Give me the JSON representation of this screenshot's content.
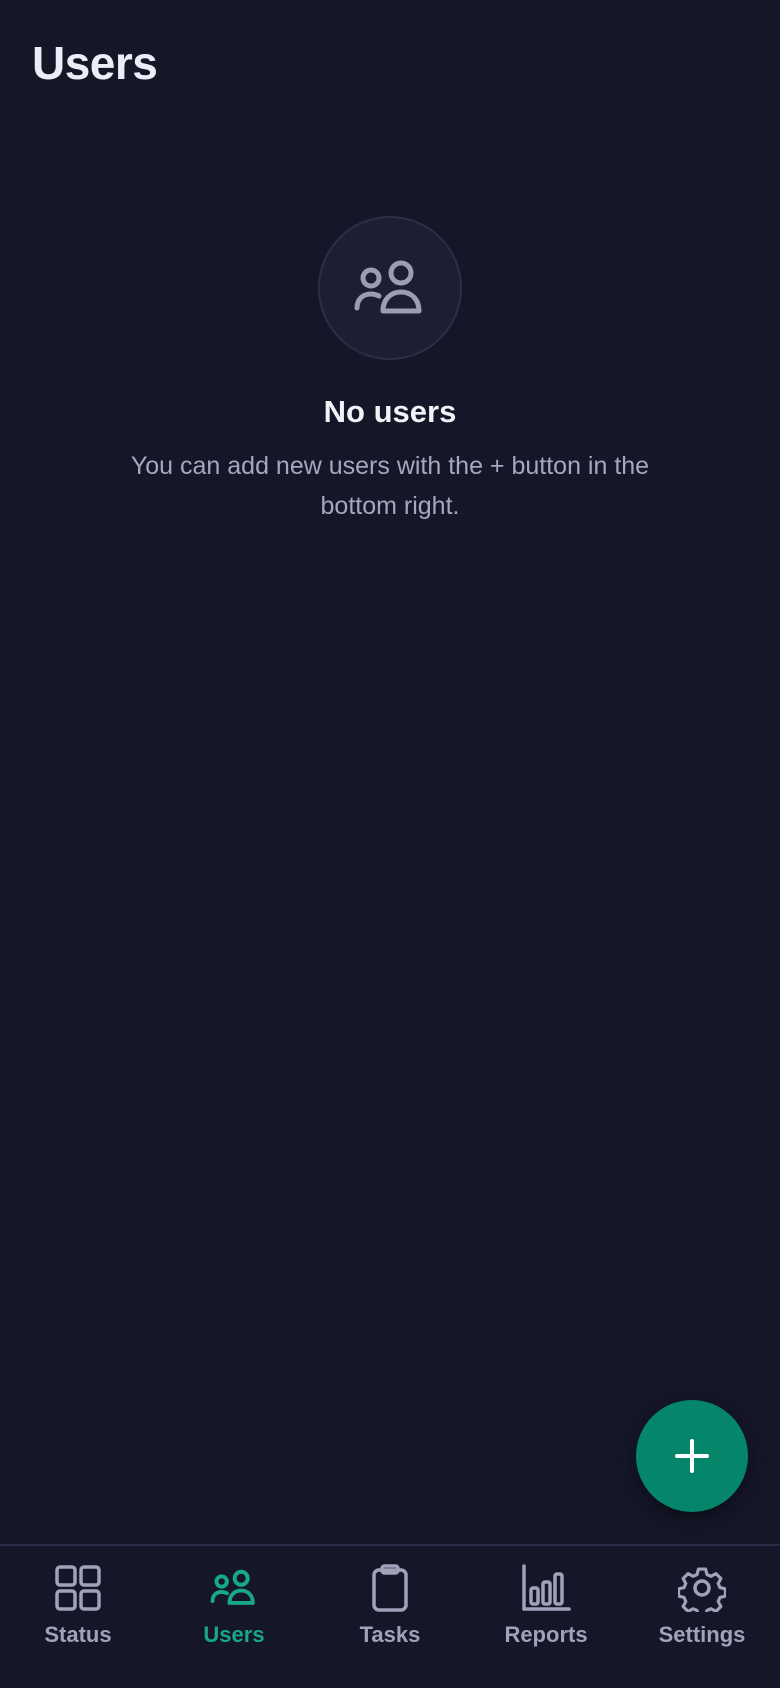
{
  "header": {
    "title": "Users"
  },
  "empty_state": {
    "icon": "users-icon",
    "title": "No users",
    "description": "You can add new users with the + button in the bottom right."
  },
  "fab": {
    "icon": "plus-icon",
    "color": "#05866a"
  },
  "nav": {
    "active_color": "#17a884",
    "inactive_color": "#9fa2b8",
    "items": [
      {
        "label": "Status",
        "icon": "grid-icon",
        "active": false
      },
      {
        "label": "Users",
        "icon": "users-icon",
        "active": true
      },
      {
        "label": "Tasks",
        "icon": "clipboard-icon",
        "active": false
      },
      {
        "label": "Reports",
        "icon": "bar-chart-icon",
        "active": false
      },
      {
        "label": "Settings",
        "icon": "gear-icon",
        "active": false
      }
    ]
  },
  "colors": {
    "background": "#151729",
    "title_text": "#eceef7",
    "secondary_text": "#a4a7bd"
  }
}
